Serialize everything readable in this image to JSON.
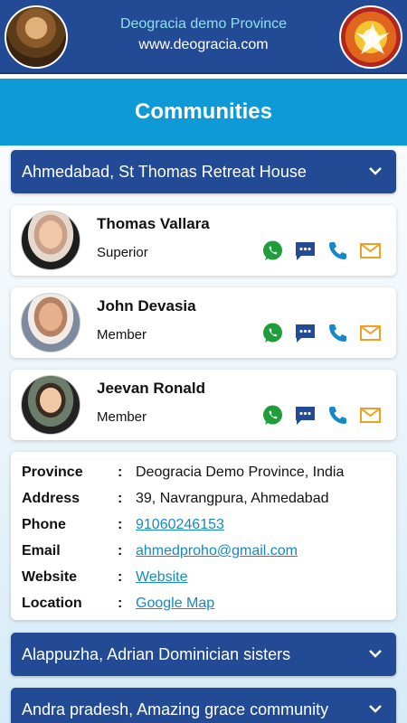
{
  "header": {
    "title": "Deogracia demo Province",
    "url": "www.deogracia.com"
  },
  "page_title": "Communities",
  "communities": [
    {
      "name": "Ahmedabad, St Thomas Retreat House"
    },
    {
      "name": "Alappuzha, Adrian Dominician sisters"
    },
    {
      "name": "Andra pradesh, Amazing grace community"
    }
  ],
  "members": [
    {
      "name": "Thomas Vallara",
      "role": "Superior"
    },
    {
      "name": "John Devasia",
      "role": "Member"
    },
    {
      "name": "Jeevan Ronald",
      "role": "Member"
    }
  ],
  "details": {
    "colon": ":",
    "province_label": "Province",
    "province_value": "Deogracia Demo Province, India",
    "address_label": "Address",
    "address_value": "39, Navrangpura, Ahmedabad",
    "phone_label": "Phone",
    "phone_value": "91060246153",
    "email_label": "Email",
    "email_value": "ahmedproho@gmail.com",
    "website_label": "Website",
    "website_value": "Website",
    "location_label": "Location",
    "location_value": "Google Map"
  },
  "colors": {
    "header_bg": "#234a94",
    "title_bar_bg": "#0e9ad6",
    "whatsapp": "#1f9d3a",
    "sms": "#234a94",
    "phone": "#1589c7",
    "email": "#f0a020",
    "link": "#1589c7"
  },
  "icons": [
    "whatsapp-icon",
    "message-icon",
    "phone-icon",
    "email-icon",
    "chevron-down-icon"
  ]
}
